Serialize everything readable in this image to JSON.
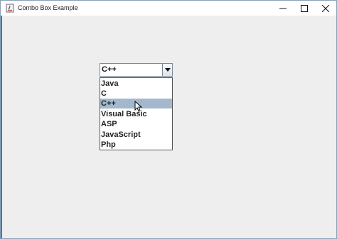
{
  "window": {
    "title": "Combo Box Example",
    "controls": {
      "minimize_icon": "minimize-icon",
      "maximize_icon": "maximize-icon",
      "close_icon": "close-icon"
    }
  },
  "combo": {
    "selected": "C++",
    "dropdown_icon": "chevron-down-icon",
    "options": [
      "Java",
      "C",
      "C++",
      "Visual Basic",
      "ASP",
      "JavaScript",
      "Php"
    ],
    "highlighted_index": 2
  },
  "colors": {
    "highlight": "#a3b8cc",
    "background": "#eeeeee"
  }
}
